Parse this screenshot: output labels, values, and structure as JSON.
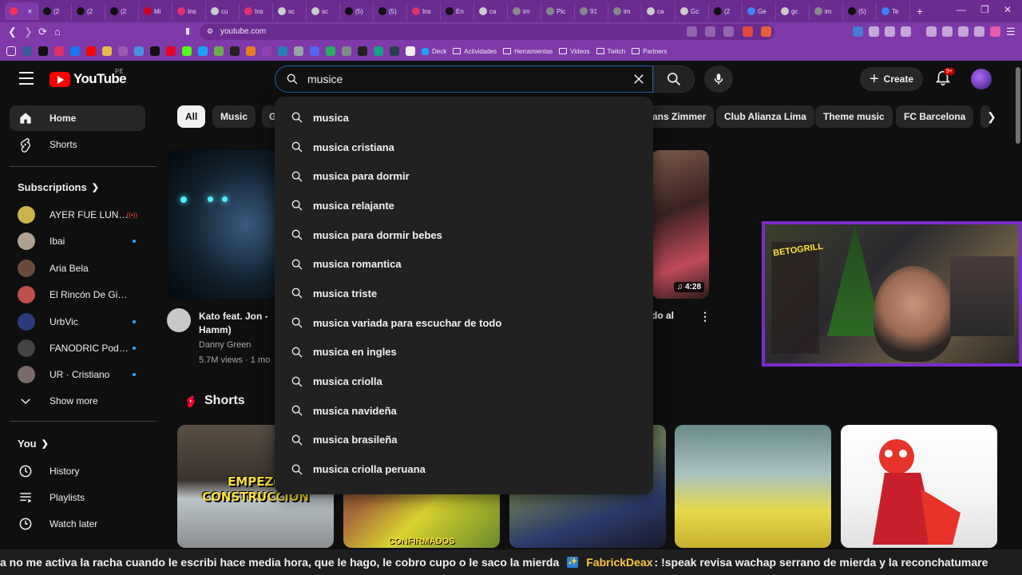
{
  "browser": {
    "tabs": [
      {
        "label": "",
        "color": "#ff2d55",
        "active": true
      },
      {
        "label": "(2",
        "color": "#111111"
      },
      {
        "label": "(2",
        "color": "#111111"
      },
      {
        "label": "(2",
        "color": "#111111"
      },
      {
        "label": "Mi",
        "color": "#d0021b"
      },
      {
        "label": "Ins",
        "color": "#e1306c"
      },
      {
        "label": "cu",
        "color": "#cccccc"
      },
      {
        "label": "Ins",
        "color": "#e1306c"
      },
      {
        "label": "sc",
        "color": "#cccccc"
      },
      {
        "label": "sc",
        "color": "#cccccc"
      },
      {
        "label": "(5)",
        "color": "#111111"
      },
      {
        "label": "(5)",
        "color": "#111111"
      },
      {
        "label": "Ins",
        "color": "#e1306c"
      },
      {
        "label": "En",
        "color": "#111111"
      },
      {
        "label": "ca",
        "color": "#cccccc"
      },
      {
        "label": "im",
        "color": "#888888"
      },
      {
        "label": "Pic",
        "color": "#888888"
      },
      {
        "label": "91",
        "color": "#888888"
      },
      {
        "label": "im",
        "color": "#888888"
      },
      {
        "label": "ca",
        "color": "#cccccc"
      },
      {
        "label": "Gc",
        "color": "#cccccc"
      },
      {
        "label": "(2",
        "color": "#111111"
      },
      {
        "label": "Ge",
        "color": "#4285f4"
      },
      {
        "label": "gc",
        "color": "#cccccc"
      },
      {
        "label": "im",
        "color": "#888888"
      },
      {
        "label": "(5)",
        "color": "#111111"
      },
      {
        "label": "Te",
        "color": "#3b82f6"
      }
    ],
    "url": "youtube.com",
    "bookmarks": [
      {
        "label": "Deck"
      },
      {
        "label": "Actividades"
      },
      {
        "label": "Herramientas"
      },
      {
        "label": "Videos"
      },
      {
        "label": "Twitch"
      },
      {
        "label": "Partners"
      }
    ]
  },
  "header": {
    "logo_text": "YouTube",
    "country_code": "PE",
    "search_value": "musice",
    "create_label": "Create",
    "notif_badge": "9+"
  },
  "sidebar": {
    "home": "Home",
    "shorts": "Shorts",
    "subscriptions_label": "Subscriptions",
    "subscriptions": [
      {
        "name": "AYER FUE LUNES",
        "status": "live",
        "color": "#c9b34a"
      },
      {
        "name": "Ibai",
        "status": "dot",
        "color": "#b0a090"
      },
      {
        "name": "Aria Bela",
        "status": "",
        "color": "#6b4a3e"
      },
      {
        "name": "El Rincón De Giorgio",
        "status": "",
        "color": "#c0504d"
      },
      {
        "name": "UrbVic",
        "status": "dot",
        "color": "#2b3b7a"
      },
      {
        "name": "FANODRIC Podc...",
        "status": "dot",
        "color": "#444444"
      },
      {
        "name": "UR · Cristiano",
        "status": "dot",
        "color": "#7a6a6a"
      }
    ],
    "show_more": "Show more",
    "you_label": "You",
    "you_items": [
      {
        "label": "History",
        "icon": "history-icon"
      },
      {
        "label": "Playlists",
        "icon": "playlists-icon"
      },
      {
        "label": "Watch later",
        "icon": "watch-later-icon"
      }
    ]
  },
  "chips": [
    "All",
    "Music",
    "G",
    "ans Zimmer",
    "Club Alianza Lima",
    "Theme music",
    "FC Barcelona"
  ],
  "main": {
    "video1": {
      "title_line1": "Kato feat. Jon -",
      "title_line2": "Hamm)",
      "channel": "Danny Green",
      "meta": "5.7M views · 1 mo"
    },
    "video2": {
      "duration": "4:28",
      "title_fragment": "do al"
    },
    "shorts_label": "Shorts",
    "short1_caption_line1": "EMPEZO",
    "short1_caption_line2": "CONSTRUCCION",
    "short2_caption": "CONFIRMADOS"
  },
  "suggestions": [
    "musica",
    "musica cristiana",
    "musica para dormir",
    "musica relajante",
    "musica para dormir bebes",
    "musica romantica",
    "musica triste",
    "musica variada para escuchar de todo",
    "musica en ingles",
    "musica criolla",
    "musica navideña",
    "musica brasileña",
    "musica criolla peruana"
  ],
  "ticker": {
    "text_before": "a no me activa la racha cuando le escribi hace media hora, que le hago, le cobro cupo o le saco la mierda",
    "user": "FabrickDeax",
    "text_after": ": !speak revisa wachap serrano de mierda y la reconchatumare"
  },
  "colors": {
    "youtube_red": "#ff0000",
    "browser_purple": "#7d3aa8",
    "webcam_border": "#7b2cc9",
    "accent_blue": "#3ea6ff"
  }
}
